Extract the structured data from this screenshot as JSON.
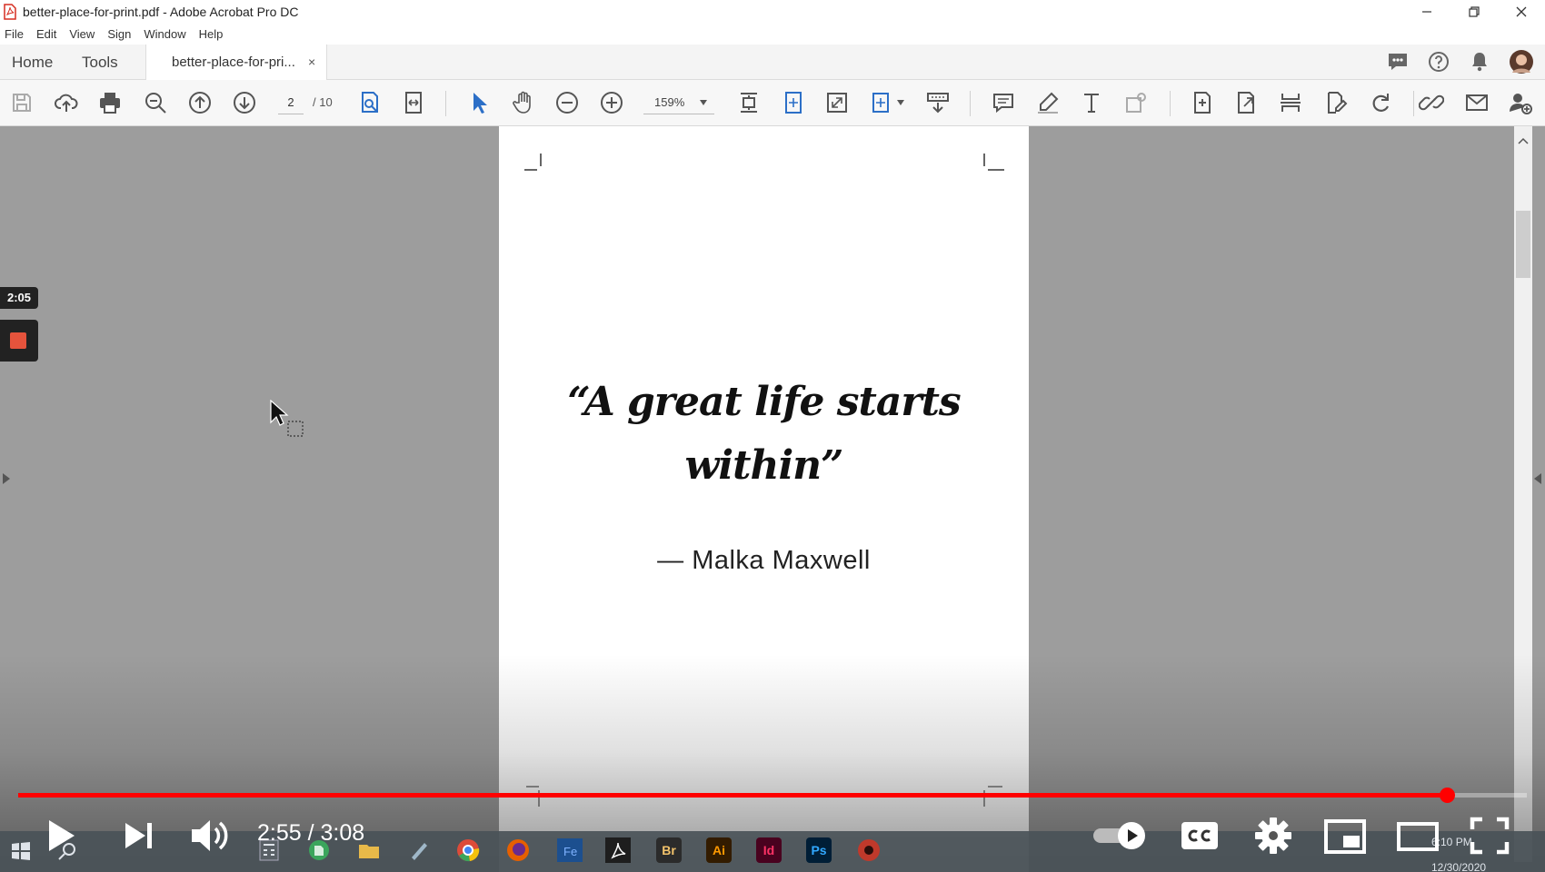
{
  "window": {
    "title": "better-place-for-print.pdf - Adobe Acrobat Pro DC"
  },
  "menu": [
    "File",
    "Edit",
    "View",
    "Sign",
    "Window",
    "Help"
  ],
  "tabs": {
    "home": "Home",
    "tools": "Tools",
    "document": "better-place-for-pri...",
    "close": "×"
  },
  "toolbar": {
    "current_page": "2",
    "page_total": "/ 10",
    "zoom": "159%"
  },
  "document": {
    "quote_line1": "“A great life starts",
    "quote_line2": "within”",
    "author": "— Malka Maxwell"
  },
  "recorder": {
    "elapsed": "2:05"
  },
  "player": {
    "time": "2:55 / 3:08",
    "progress": 0.947
  },
  "taskbar": {
    "apps": [
      {
        "label": "Br",
        "color": "#2b2b2b",
        "fg": "#f3c36b"
      },
      {
        "label": "Ai",
        "color": "#331c00",
        "fg": "#ff9a00"
      },
      {
        "label": "Id",
        "color": "#49021f",
        "fg": "#ff3366"
      },
      {
        "label": "Ps",
        "color": "#001e36",
        "fg": "#31a8ff"
      }
    ],
    "time": "6:10 PM",
    "date": "12/30/2020"
  },
  "colors": {
    "progress": "#ff0000",
    "acrobat_blue": "#2c6fc7",
    "page_bg": "#ffffff",
    "canvas_bg": "#9d9d9d"
  }
}
